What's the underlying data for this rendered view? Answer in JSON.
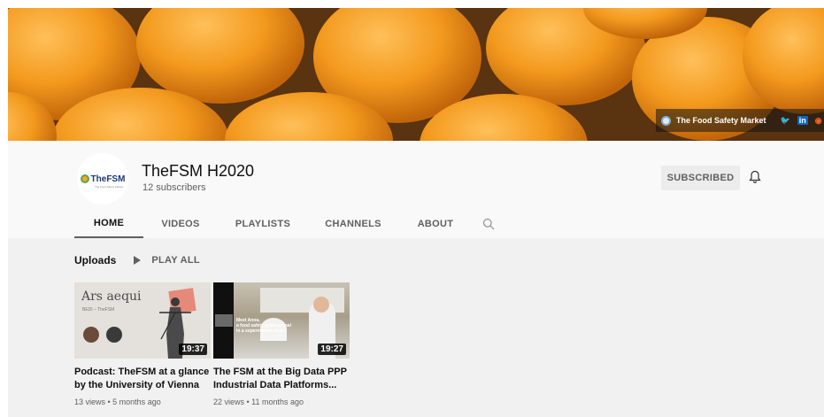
{
  "banner": {
    "brand_text": "The Food Safety Market",
    "social_icons": [
      "twitter-icon",
      "linkedin-icon",
      "rss-icon"
    ],
    "twitter_glyph": "🐦",
    "linkedin_glyph": "in",
    "rss_glyph": "◉"
  },
  "channel": {
    "avatar_text": "TheFSM",
    "avatar_subtext": "The Food Safety Market",
    "title": "TheFSM H2020",
    "subscribers": "12 subscribers",
    "subscribed_label": "SUBSCRIBED"
  },
  "tabs": [
    {
      "label": "HOME",
      "active": true
    },
    {
      "label": "VIDEOS",
      "active": false
    },
    {
      "label": "PLAYLISTS",
      "active": false
    },
    {
      "label": "CHANNELS",
      "active": false
    },
    {
      "label": "ABOUT",
      "active": false
    }
  ],
  "uploads": {
    "label": "Uploads",
    "play_all_label": "PLAY ALL"
  },
  "videos": [
    {
      "title_line1": "Podcast: TheFSM at a glance",
      "title_line2": "by the University of Vienna",
      "duration": "19:37",
      "meta": "13 views • 5 months ago",
      "thumb_title": "Ars aequi",
      "thumb_subtitle": "BEDI – TheFSM"
    },
    {
      "title_line1": "The FSM at the Big Data PPP",
      "title_line2": "Industrial Data Platforms...",
      "duration": "19:27",
      "meta": "22 views • 11 months ago",
      "thumb_text": "Meet Anna,\na food safety professional\nin a supermarket chain"
    }
  ],
  "colors": {
    "banner_orange": "#f39a1e",
    "header_bg": "#f9f9f9",
    "content_bg": "#f1f1f1",
    "text_primary": "#0f0f0f",
    "text_secondary": "#606060",
    "subscribed_bg": "#ececec"
  }
}
